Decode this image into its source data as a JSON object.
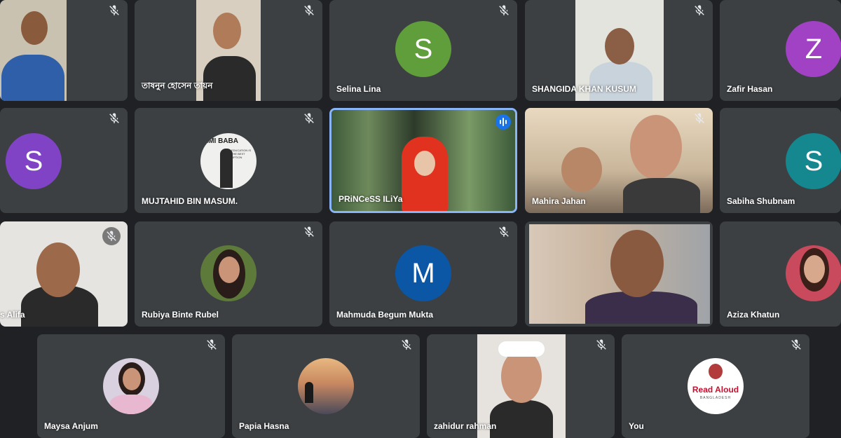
{
  "meeting": {
    "participants": [
      {
        "name": "",
        "muted": true
      },
      {
        "name": "তাষনুন হোসেন তায়ন",
        "muted": true
      },
      {
        "name": "Selina Lina",
        "muted": true,
        "initial": "S",
        "avatar_color": "#5f9e3a"
      },
      {
        "name": "SHANGIDA KHAN KUSUM",
        "muted": true
      },
      {
        "name": "Zafir Hasan",
        "muted": false,
        "initial": "Z",
        "avatar_color": "#a142c4"
      },
      {
        "name": "",
        "muted": true,
        "initial": "S",
        "avatar_color": "#8043c5"
      },
      {
        "name": "MUJTAHID BIN MASUM.",
        "muted": true,
        "photo_text": "AMI BABA",
        "photo_caption": "EDUCATION IS THE BEST OPTION"
      },
      {
        "name": "PRiNCeSS ILiYa",
        "speaking": true
      },
      {
        "name": "Mahira Jahan",
        "muted": true
      },
      {
        "name": "Sabiha Shubnam",
        "muted": false,
        "initial": "S",
        "avatar_color": "#14878f"
      },
      {
        "name": "s Alifa",
        "muted": true
      },
      {
        "name": "Rubiya Binte Rubel",
        "muted": true
      },
      {
        "name": "Mahmuda Begum Mukta",
        "muted": true,
        "initial": "M",
        "avatar_color": "#0b57a6"
      },
      {
        "name": "",
        "muted": false
      },
      {
        "name": "Aziza Khatun",
        "muted": false
      },
      {
        "name": "Maysa Anjum",
        "muted": true
      },
      {
        "name": "Papia Hasna",
        "muted": true
      },
      {
        "name": "zahidur rahman",
        "muted": true
      },
      {
        "name": "You",
        "muted": true,
        "logo_line1": "Read Aloud",
        "logo_line2": "BANGLADESH"
      }
    ]
  },
  "colors": {
    "background": "#202124",
    "tile": "#3c4043",
    "speaking_border": "#8ab4f8"
  },
  "icons": {
    "muted": "mic-off-icon",
    "speaking": "audio-level-icon"
  }
}
